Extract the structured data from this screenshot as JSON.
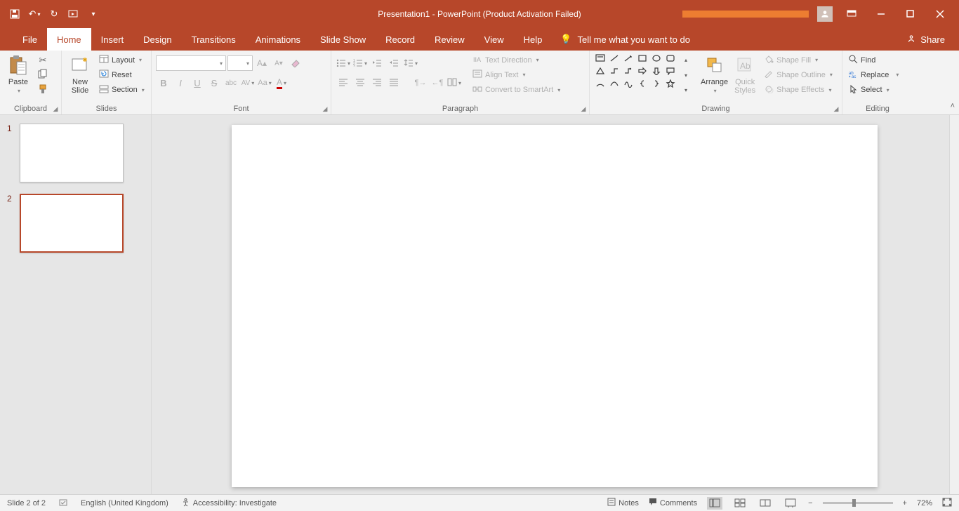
{
  "title": "Presentation1  -  PowerPoint (Product Activation Failed)",
  "tabs": {
    "file": "File",
    "home": "Home",
    "insert": "Insert",
    "design": "Design",
    "transitions": "Transitions",
    "animations": "Animations",
    "slideshow": "Slide Show",
    "record": "Record",
    "review": "Review",
    "view": "View",
    "help": "Help",
    "tellme": "Tell me what you want to do",
    "share": "Share"
  },
  "ribbon": {
    "clipboard": {
      "label": "Clipboard",
      "paste": "Paste"
    },
    "slides": {
      "label": "Slides",
      "newslide": "New\nSlide",
      "layout": "Layout",
      "reset": "Reset",
      "section": "Section"
    },
    "font": {
      "label": "Font",
      "name": "",
      "size": ""
    },
    "paragraph": {
      "label": "Paragraph",
      "textdir": "Text Direction",
      "align": "Align Text",
      "smartart": "Convert to SmartArt"
    },
    "drawing": {
      "label": "Drawing",
      "arrange": "Arrange",
      "quick": "Quick\nStyles",
      "fill": "Shape Fill",
      "outline": "Shape Outline",
      "effects": "Shape Effects"
    },
    "editing": {
      "label": "Editing",
      "find": "Find",
      "replace": "Replace",
      "select": "Select"
    }
  },
  "slides": [
    {
      "num": "1",
      "selected": false
    },
    {
      "num": "2",
      "selected": true
    }
  ],
  "status": {
    "slide": "Slide 2 of 2",
    "lang": "English (United Kingdom)",
    "access": "Accessibility: Investigate",
    "notes": "Notes",
    "comments": "Comments",
    "zoom": "72%"
  }
}
